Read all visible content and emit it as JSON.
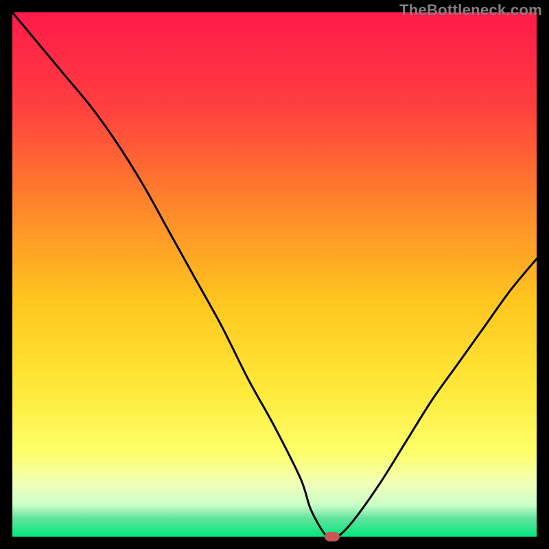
{
  "watermark": "TheBottleneck.com",
  "chart_data": {
    "type": "line",
    "title": "",
    "xlabel": "",
    "ylabel": "",
    "xlim": [
      0,
      100
    ],
    "ylim": [
      0,
      100
    ],
    "grid": false,
    "series": [
      {
        "name": "bottleneck-curve",
        "x": [
          0,
          5,
          10,
          15,
          20,
          25,
          30,
          35,
          40,
          45,
          50,
          55,
          57,
          60,
          62,
          65,
          70,
          75,
          80,
          85,
          90,
          95,
          100
        ],
        "y": [
          100,
          94,
          88,
          82,
          75,
          67,
          58,
          49,
          40,
          30,
          21,
          11,
          5,
          0,
          0,
          3,
          10,
          18,
          26,
          33,
          40,
          47,
          53
        ]
      }
    ],
    "marker": {
      "x": 61,
      "y": 0,
      "color": "#c95757"
    },
    "gradient_stops": [
      {
        "offset": 0.0,
        "color": "#ff1a4b"
      },
      {
        "offset": 0.18,
        "color": "#ff3f3f"
      },
      {
        "offset": 0.38,
        "color": "#ff8a2a"
      },
      {
        "offset": 0.55,
        "color": "#ffc61f"
      },
      {
        "offset": 0.72,
        "color": "#ffe93a"
      },
      {
        "offset": 0.84,
        "color": "#fdff6a"
      },
      {
        "offset": 0.9,
        "color": "#f1ffba"
      },
      {
        "offset": 0.94,
        "color": "#c9ffc9"
      },
      {
        "offset": 0.965,
        "color": "#63e29e"
      },
      {
        "offset": 1.0,
        "color": "#00e97e"
      }
    ],
    "border_width_px": 18,
    "curve_stroke_px": 3
  }
}
